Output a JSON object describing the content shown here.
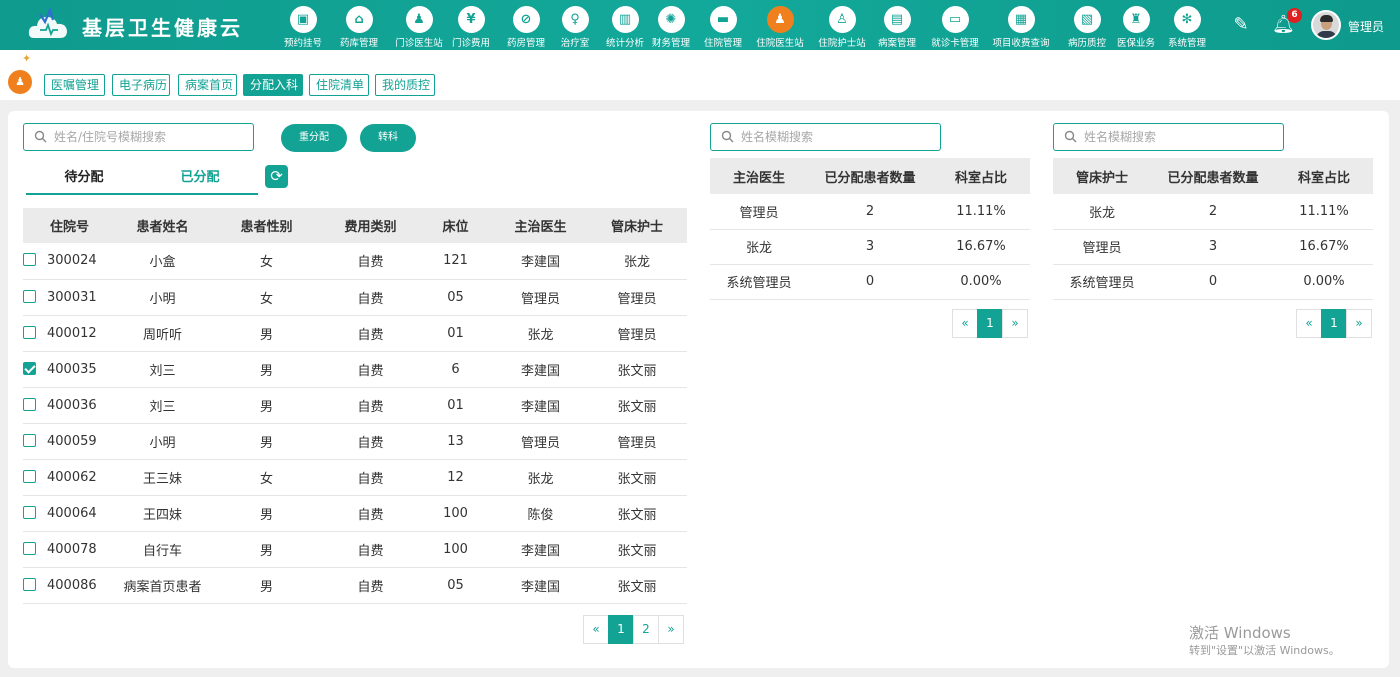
{
  "app": {
    "title": "基层卫生健康云"
  },
  "nav": [
    {
      "label": "预约挂号",
      "icon": "calendar-icon",
      "glyph": "▣"
    },
    {
      "label": "药库管理",
      "icon": "warehouse-icon",
      "glyph": "⌂"
    },
    {
      "label": "门诊医生站",
      "icon": "doctor-icon",
      "glyph": "♟"
    },
    {
      "label": "门诊费用",
      "icon": "yen-icon",
      "glyph": "¥"
    },
    {
      "label": "药房管理",
      "icon": "pill-icon",
      "glyph": "⊘"
    },
    {
      "label": "治疗室",
      "icon": "nurse-icon",
      "glyph": "♀"
    },
    {
      "label": "统计分析",
      "icon": "bar-chart-icon",
      "glyph": "▥"
    },
    {
      "label": "财务管理",
      "icon": "gear-coin-icon",
      "glyph": "✺"
    },
    {
      "label": "住院管理",
      "icon": "bed-icon",
      "glyph": "▬"
    },
    {
      "label": "住院医生站",
      "icon": "inpatient-doctor-icon",
      "glyph": "♟"
    },
    {
      "label": "住院护士站",
      "icon": "nurse-station-icon",
      "glyph": "♙"
    },
    {
      "label": "病案管理",
      "icon": "record-icon",
      "glyph": "▤"
    },
    {
      "label": "就诊卡管理",
      "icon": "card-icon",
      "glyph": "▭"
    },
    {
      "label": "项目收费查询",
      "icon": "receipt-icon",
      "glyph": "▦"
    },
    {
      "label": "病历质控",
      "icon": "clipboard-icon",
      "glyph": "▧"
    },
    {
      "label": "医保业务",
      "icon": "insurance-icon",
      "glyph": "♜"
    },
    {
      "label": "系统管理",
      "icon": "settings-icon",
      "glyph": "✻"
    }
  ],
  "nav_active_index": 9,
  "header": {
    "notification_count": "6",
    "username": "管理员"
  },
  "subtabs": [
    {
      "label": "医嘱管理",
      "active": false
    },
    {
      "label": "电子病历",
      "active": false
    },
    {
      "label": "病案首页",
      "active": false
    },
    {
      "label": "分配入科",
      "active": true
    },
    {
      "label": "住院清单",
      "active": false
    },
    {
      "label": "我的质控",
      "active": false
    }
  ],
  "left": {
    "search_placeholder": "姓名/住院号模糊搜索",
    "reassign_label": "重分配",
    "transfer_label": "转科",
    "tabs": [
      {
        "label": "待分配",
        "active": false
      },
      {
        "label": "已分配",
        "active": true
      }
    ],
    "columns": [
      "住院号",
      "患者姓名",
      "患者性别",
      "费用类别",
      "床位",
      "主治医生",
      "管床护士"
    ],
    "rows": [
      {
        "checked": false,
        "cells": [
          "300024",
          "小盒",
          "女",
          "自费",
          "121",
          "李建国",
          "张龙"
        ]
      },
      {
        "checked": false,
        "cells": [
          "300031",
          "小明",
          "女",
          "自费",
          "05",
          "管理员",
          "管理员"
        ]
      },
      {
        "checked": false,
        "cells": [
          "400012",
          "周听听",
          "男",
          "自费",
          "01",
          "张龙",
          "管理员"
        ]
      },
      {
        "checked": true,
        "cells": [
          "400035",
          "刘三",
          "男",
          "自费",
          "6",
          "李建国",
          "张文丽"
        ]
      },
      {
        "checked": false,
        "cells": [
          "400036",
          "刘三",
          "男",
          "自费",
          "01",
          "李建国",
          "张文丽"
        ]
      },
      {
        "checked": false,
        "cells": [
          "400059",
          "小明",
          "男",
          "自费",
          "13",
          "管理员",
          "管理员"
        ]
      },
      {
        "checked": false,
        "cells": [
          "400062",
          "王三妹",
          "女",
          "自费",
          "12",
          "张龙",
          "张文丽"
        ]
      },
      {
        "checked": false,
        "cells": [
          "400064",
          "王四妹",
          "男",
          "自费",
          "100",
          "陈俊",
          "张文丽"
        ]
      },
      {
        "checked": false,
        "cells": [
          "400078",
          "自行车",
          "男",
          "自费",
          "100",
          "李建国",
          "张文丽"
        ]
      },
      {
        "checked": false,
        "cells": [
          "400086",
          "病案首页患者",
          "男",
          "自费",
          "05",
          "李建国",
          "张文丽"
        ]
      }
    ],
    "pager": [
      "«",
      "1",
      "2",
      "»"
    ],
    "pager_active": "1"
  },
  "doctors": {
    "search_placeholder": "姓名模糊搜索",
    "columns": [
      "主治医生",
      "已分配患者数量",
      "科室占比"
    ],
    "rows": [
      [
        "管理员",
        "2",
        "11.11%"
      ],
      [
        "张龙",
        "3",
        "16.67%"
      ],
      [
        "系统管理员",
        "0",
        "0.00%"
      ]
    ],
    "pager": [
      "«",
      "1",
      "»"
    ],
    "pager_active": "1"
  },
  "nurses": {
    "search_placeholder": "姓名模糊搜索",
    "columns": [
      "管床护士",
      "已分配患者数量",
      "科室占比"
    ],
    "rows": [
      [
        "张龙",
        "2",
        "11.11%"
      ],
      [
        "管理员",
        "3",
        "16.67%"
      ],
      [
        "系统管理员",
        "0",
        "0.00%"
      ]
    ],
    "pager": [
      "«",
      "1",
      "»"
    ],
    "pager_active": "1"
  },
  "watermark": {
    "line1": "激活 Windows",
    "line2": "转到\"设置\"以激活 Windows。"
  },
  "colors": {
    "primary": "#13a394",
    "accent": "#f0801e",
    "badge": "#e02020"
  }
}
